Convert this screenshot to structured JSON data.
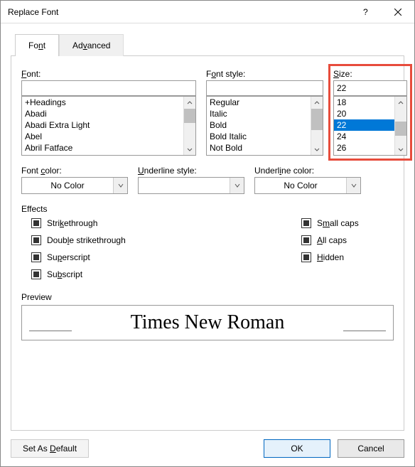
{
  "title": "Replace Font",
  "tabs": {
    "font": "Font",
    "advanced": "Advanced"
  },
  "labels": {
    "font": "Font:",
    "fontStyle": "Font style:",
    "size": "Size:",
    "fontColor": "Font color:",
    "underlineStyle": "Underline style:",
    "underlineColor": "Underline color:",
    "effects": "Effects",
    "preview": "Preview"
  },
  "font": {
    "value": "",
    "items": [
      "+Headings",
      "Abadi",
      "Abadi Extra Light",
      "Abel",
      "Abril Fatface"
    ]
  },
  "fontStyle": {
    "value": "",
    "items": [
      "Regular",
      "Italic",
      "Bold",
      "Bold Italic",
      "Not Bold"
    ]
  },
  "size": {
    "value": "22",
    "items": [
      "18",
      "20",
      "22",
      "24",
      "26"
    ],
    "selectedIndex": 2
  },
  "fontColor": "No Color",
  "underlineStyle": "",
  "underlineColor": "No Color",
  "effectsLeft": [
    "Strikethrough",
    "Double strikethrough",
    "Superscript",
    "Subscript"
  ],
  "effectsRight": [
    "Small caps",
    "All caps",
    "Hidden"
  ],
  "previewText": "Times New Roman",
  "buttons": {
    "setDefault": "Set As Default",
    "ok": "OK",
    "cancel": "Cancel"
  }
}
